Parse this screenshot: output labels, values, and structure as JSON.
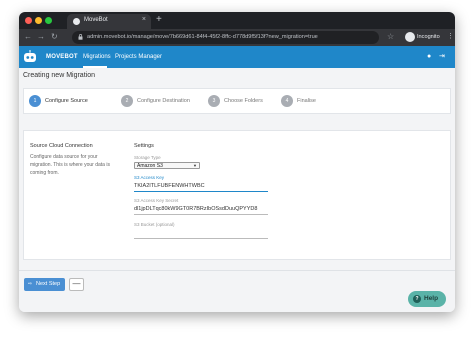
{
  "browser": {
    "tab_title": "MoveBot",
    "tab_close": "×",
    "new_tab": "+",
    "url": "admin.movebot.io/manage/move/7b669d61-84f4-45f2-8ffc-d778d9f5f13f?new_migration=true",
    "incognito_label": "Incognito",
    "traffic_colors": [
      "#fe5f57",
      "#febc2e",
      "#28c840"
    ]
  },
  "app": {
    "brand": "MOVEBOT",
    "nav": [
      "Migrations",
      "Projects Manager"
    ],
    "accent": "#1f87c9"
  },
  "page": {
    "title": "Creating new Migration",
    "steps": [
      {
        "num": "1",
        "label": "Configure Source",
        "active": true
      },
      {
        "num": "2",
        "label": "Configure Destination",
        "active": false
      },
      {
        "num": "3",
        "label": "Choose Folders",
        "active": false
      },
      {
        "num": "4",
        "label": "Finalise",
        "active": false
      }
    ]
  },
  "source": {
    "title": "Source Cloud Connection",
    "description": "Configure data source for your migration. This is where your data is coming from."
  },
  "settings": {
    "title": "Settings",
    "storage_type_label": "Storage Type",
    "storage_type_value": "Amazon S3",
    "access_key_label": "S3 Access Key",
    "access_key_value": "TKIA2ITLFUBFENWHTWBC",
    "secret_label": "S3 Access Key Secret",
    "secret_value": "dl1jpDLTqc80kW9GT0R7BRzIbOSsdDuuQPYYD8",
    "bucket_label": "S3 Bucket (optional)",
    "bucket_value": ""
  },
  "footer": {
    "next_label": "Next Step",
    "minus_label": "—"
  },
  "help": {
    "label": "Help"
  }
}
